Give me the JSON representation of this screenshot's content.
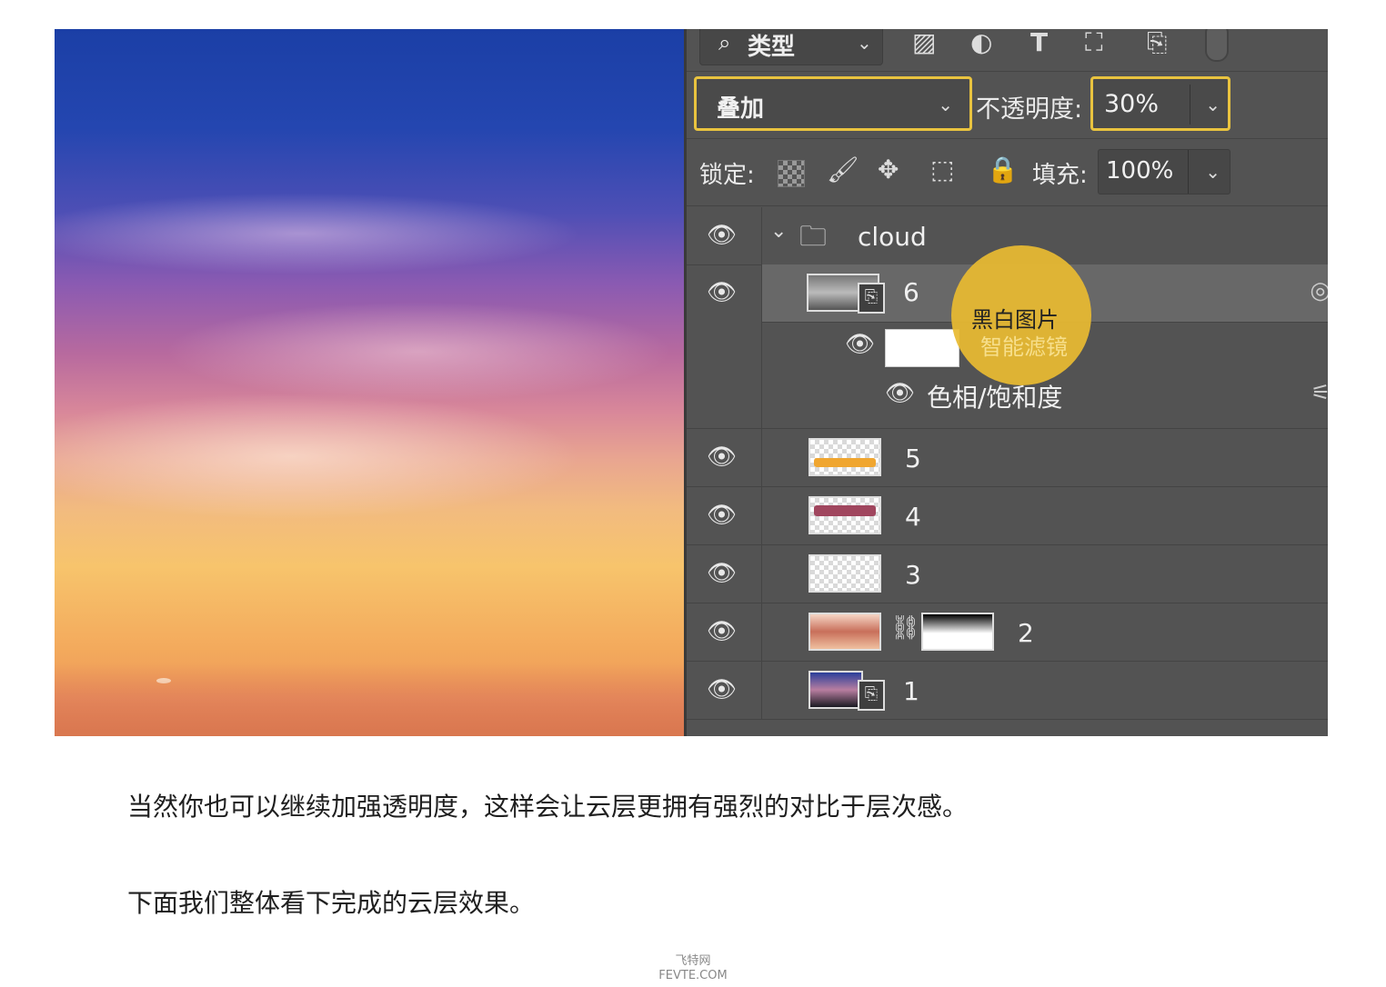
{
  "panel": {
    "filter_label": "类型",
    "filter_icons": [
      "image-icon",
      "adjustment-icon",
      "text-icon",
      "shape-icon",
      "smart-object-icon"
    ],
    "blend_mode": "叠加",
    "opacity_label": "不透明度:",
    "opacity_value": "30%",
    "lock_label": "锁定:",
    "fill_label": "填充:",
    "fill_value": "100%",
    "layers": [
      {
        "name": "cloud",
        "type": "group"
      },
      {
        "name": "6",
        "type": "smart-object",
        "selected": true
      },
      {
        "name": "",
        "type": "filter-mask"
      },
      {
        "name": "色相/饱和度",
        "type": "smart-filter"
      },
      {
        "name": "5",
        "type": "layer",
        "bar_color": "#f0a630"
      },
      {
        "name": "4",
        "type": "layer",
        "bar_color": "#a0465e"
      },
      {
        "name": "3",
        "type": "layer"
      },
      {
        "name": "2",
        "type": "layer-with-mask"
      },
      {
        "name": "1",
        "type": "smart-object"
      }
    ]
  },
  "annotation": {
    "line1": "黑白图片",
    "line2": "智能滤镜",
    "color": "#e8ba32"
  },
  "article": {
    "para1": "当然你也可以继续加强透明度，这样会让云层更拥有强烈的对比于层次感。",
    "para2": "下面我们整体看下完成的云层效果。"
  },
  "watermark": {
    "line1": "飞特网",
    "line2": "FEVTE.COM"
  }
}
